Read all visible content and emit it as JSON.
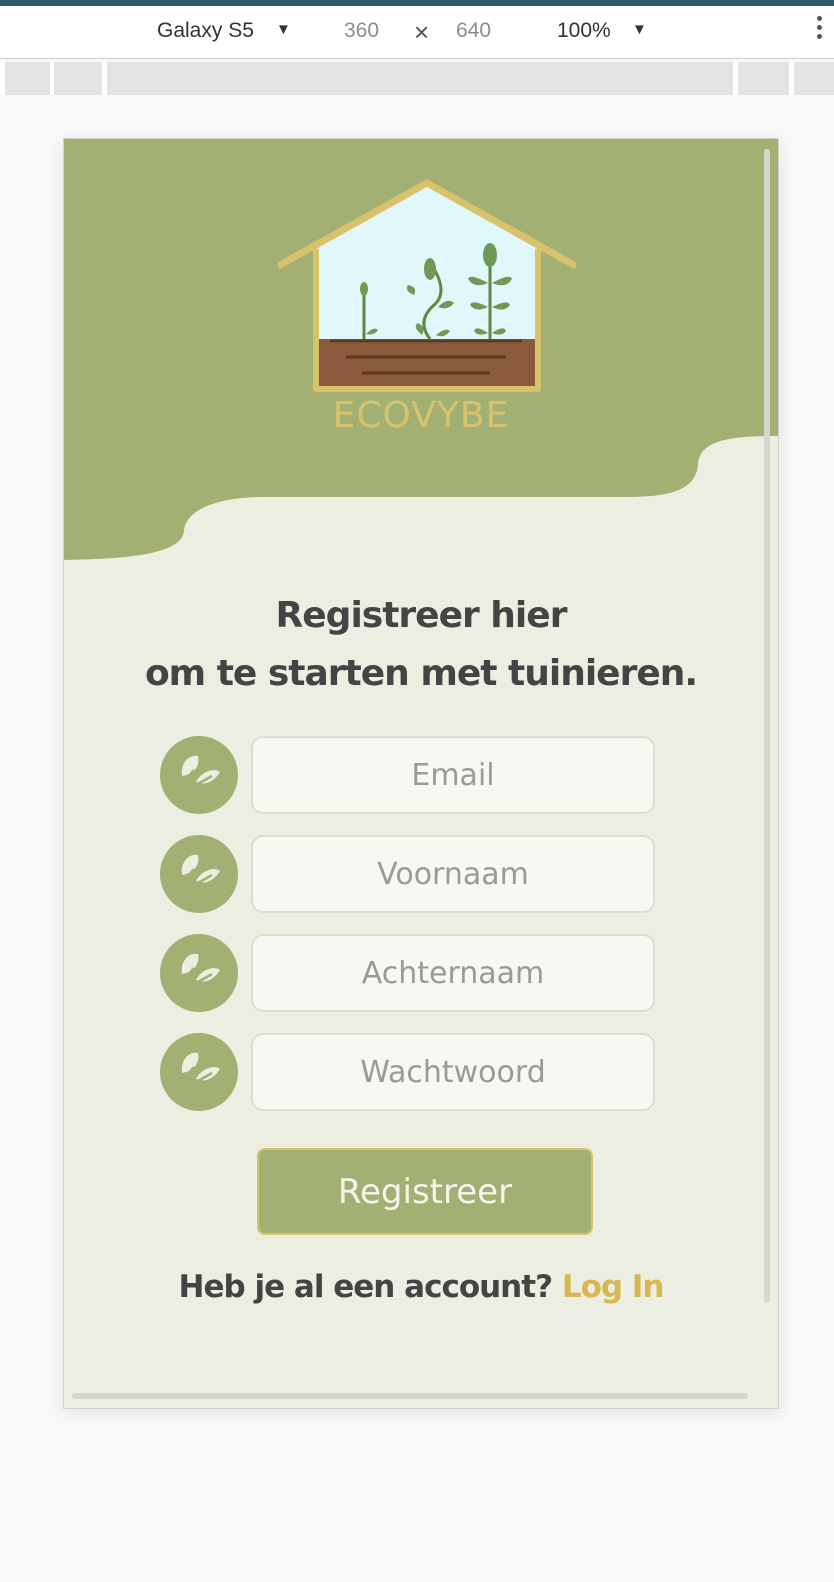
{
  "devtools": {
    "device_name": "Galaxy S5",
    "width": "360",
    "times": "×",
    "height": "640",
    "zoom": "100%",
    "caret": "▼"
  },
  "app": {
    "brand": "ECOVYBE",
    "headline_line1": "Registreer hier",
    "headline_line2": "om te starten met tuinieren.",
    "fields": {
      "email_placeholder": "Email",
      "firstname_placeholder": "Voornaam",
      "lastname_placeholder": "Achternaam",
      "password_placeholder": "Wachtwoord"
    },
    "submit_label": "Registreer",
    "login_prompt": "Heb je al een account?",
    "login_link": "Log In"
  },
  "colors": {
    "header_green": "#a3b074",
    "cream": "#eceee1",
    "gold": "#d8c26b",
    "soil": "#8b5a3c",
    "sky": "#e0f8fa",
    "leaf": "#6f9a55",
    "text_dark": "#444444"
  },
  "icons": [
    "leaf-icon",
    "more-vert-icon",
    "caret-down-icon"
  ]
}
